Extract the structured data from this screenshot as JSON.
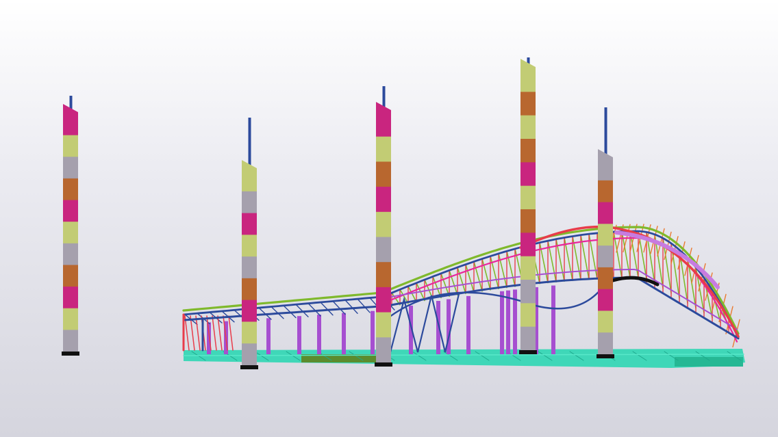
{
  "scene": {
    "palette": {
      "magenta": "#c9257f",
      "olive": "#c2cc74",
      "gray": "#a5a0ad",
      "brown": "#b8672f",
      "pink": "#e8269a",
      "steel_blue": "#2c4a9c",
      "purple": "#a64fd0",
      "lime": "#7fb92c",
      "red": "#e83c4a",
      "yellow": "#f2e23a",
      "orange": "#ea7a30",
      "lilac": "#c77be0",
      "teal": "#2dd6b3",
      "dark_green": "#5b8c2e",
      "black": "#111111"
    },
    "objects": [
      "column-1",
      "column-2",
      "column-3",
      "column-4",
      "column-5",
      "roof-truss-structure",
      "ground-slab"
    ]
  }
}
